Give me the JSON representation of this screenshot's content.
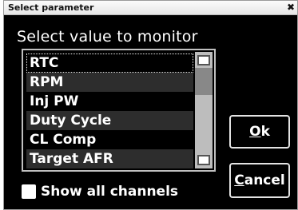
{
  "dialog": {
    "title": "Select parameter",
    "close_glyph": "✖",
    "prompt": "Select value to monitor"
  },
  "list": {
    "items": [
      "RTC",
      "RPM",
      "Inj PW",
      "Duty Cycle",
      "CL Comp",
      "Target AFR"
    ],
    "selected": "RTC"
  },
  "buttons": {
    "ok_mnemonic": "O",
    "ok_rest": "k",
    "cancel_mnemonic": "C",
    "cancel_rest": "ancel"
  },
  "show_all": {
    "label": "Show all channels",
    "checked": false
  }
}
